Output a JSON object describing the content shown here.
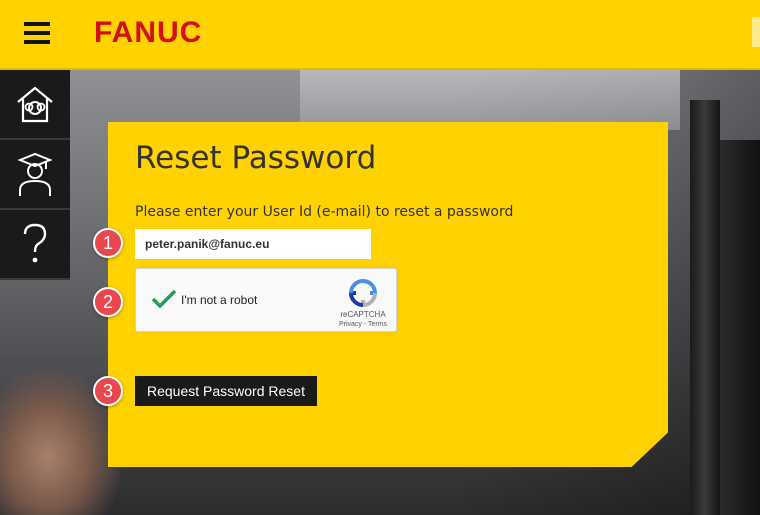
{
  "header": {
    "brand": "FANUC",
    "brand_color": "#d40f1c",
    "accent_color": "#ffd200",
    "menu_icon": "hamburger-menu-icon"
  },
  "sidenav": {
    "items": [
      {
        "name": "home",
        "icon": "home-icon"
      },
      {
        "name": "academy",
        "icon": "graduate-icon"
      },
      {
        "name": "help",
        "icon": "question-icon"
      }
    ]
  },
  "form": {
    "title": "Reset Password",
    "instructions": "Please enter your User Id (e-mail) to reset a password",
    "email_value": "peter.panik@fanuc.eu",
    "captcha": {
      "label": "I'm not a robot",
      "checked": true,
      "brand": "reCAPTCHA",
      "privacy": "Privacy",
      "separator": " - ",
      "terms": "Terms"
    },
    "submit_label": "Request Password Reset"
  },
  "markers": [
    "1",
    "2",
    "3"
  ]
}
